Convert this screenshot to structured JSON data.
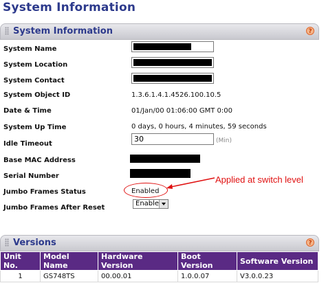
{
  "page_title": "System Information",
  "system_panel": {
    "title": "System Information",
    "help": "?",
    "rows": {
      "system_name": "System Name",
      "system_location": "System Location",
      "system_contact": "System Contact",
      "system_object_id": {
        "label": "System Object ID",
        "value": "1.3.6.1.4.1.4526.100.10.5"
      },
      "date_time": {
        "label": "Date & Time",
        "value": "01/Jan/00 01:06:00 GMT 0:00"
      },
      "up_time": {
        "label": "System Up Time",
        "value": "0 days, 0 hours, 4 minutes, 59 seconds"
      },
      "idle_timeout": {
        "label": "Idle Timeout",
        "value": "30",
        "unit": "(Min)"
      },
      "base_mac": {
        "label": "Base MAC Address"
      },
      "serial_number": {
        "label": "Serial Number"
      },
      "jumbo_status": {
        "label": "Jumbo Frames Status",
        "value": "Enabled"
      },
      "jumbo_after_reset": {
        "label": "Jumbo Frames After Reset",
        "value": "Enable"
      }
    }
  },
  "annotation": "Applied at switch level",
  "versions_panel": {
    "title": "Versions",
    "help": "?",
    "columns": [
      "Unit No.",
      "Model Name",
      "Hardware Version",
      "Boot Version",
      "Software Version"
    ],
    "rows": [
      [
        "1",
        "GS748TS",
        "00.00.01",
        "1.0.0.07",
        "V3.0.0.23"
      ]
    ]
  },
  "colors": {
    "accent": "#2d3a8c",
    "table_header": "#5a2a84",
    "annotation": "#e01010"
  }
}
